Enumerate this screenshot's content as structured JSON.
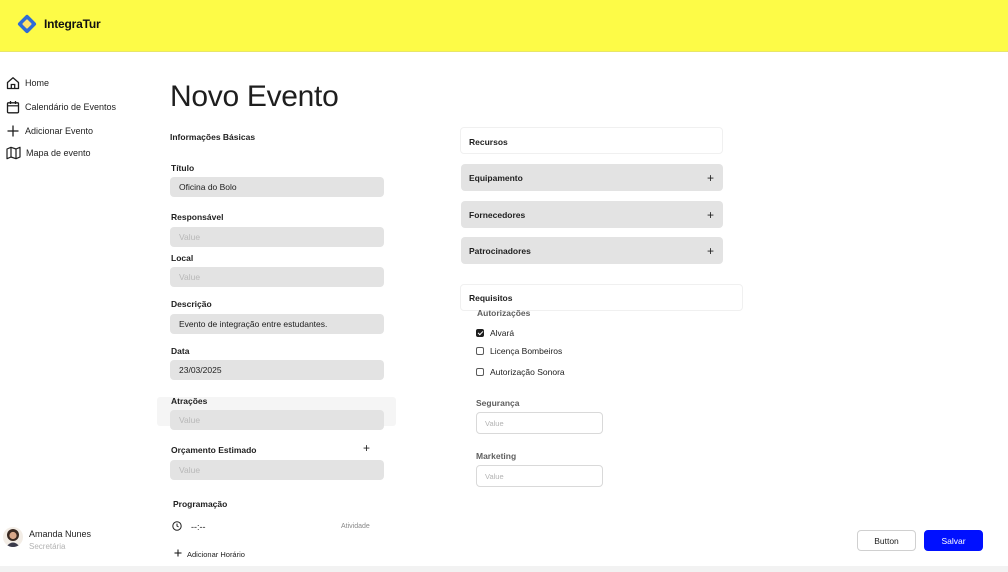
{
  "brand": {
    "name": "IntegraTur",
    "colors": {
      "header": "#fdfb47",
      "logo_blue": "#2e6bd6",
      "logo_yellow": "#ffe36a",
      "primary_button": "#0010ff"
    }
  },
  "sidebar": {
    "items": [
      {
        "label": "Home",
        "icon": "home-icon"
      },
      {
        "label": "Calendário de Eventos",
        "icon": "calendar-icon"
      },
      {
        "label": "Adicionar Evento",
        "icon": "plus-icon"
      },
      {
        "label": "Mapa de evento",
        "icon": "map-icon"
      }
    ],
    "user": {
      "name": "Amanda Nunes",
      "role": "Secretária"
    }
  },
  "page": {
    "title": "Novo Evento"
  },
  "basic_info": {
    "section_label": "Informações Básicas",
    "titulo": {
      "label": "Título",
      "value": "Oficina do Bolo"
    },
    "responsavel": {
      "label": "Responsável",
      "placeholder": "Value"
    },
    "local": {
      "label": "Local",
      "placeholder": "Value"
    },
    "descricao": {
      "label": "Descrição",
      "value": "Evento de integração entre estudantes."
    },
    "data": {
      "label": "Data",
      "value": "23/03/2025"
    },
    "atracoes": {
      "label": "Atrações",
      "placeholder": "Value"
    },
    "orcamento": {
      "label": "Orçamento Estimado",
      "placeholder": "Value",
      "add_symbol": "+"
    }
  },
  "programacao": {
    "label": "Programação",
    "time_value": "--:--",
    "activity_placeholder": "Atividade",
    "add_label": "Adicionar Horário"
  },
  "recursos": {
    "label": "Recursos",
    "sections": [
      {
        "label": "Equipamento",
        "symbol": "+"
      },
      {
        "label": "Fornecedores",
        "symbol": "+"
      },
      {
        "label": "Patrocinadores",
        "symbol": "+"
      }
    ]
  },
  "requisitos": {
    "label": "Requisitos",
    "autorizacoes": {
      "label": "Autorizações",
      "options": [
        {
          "label": "Alvará",
          "checked": true
        },
        {
          "label": "Licença Bombeiros",
          "checked": false
        },
        {
          "label": "Autorização Sonora",
          "checked": false
        }
      ]
    },
    "seguranca": {
      "label": "Segurança",
      "placeholder": "Value"
    },
    "marketing": {
      "label": "Marketing",
      "placeholder": "Value"
    }
  },
  "actions": {
    "secondary_label": "Button",
    "primary_label": "Salvar"
  }
}
